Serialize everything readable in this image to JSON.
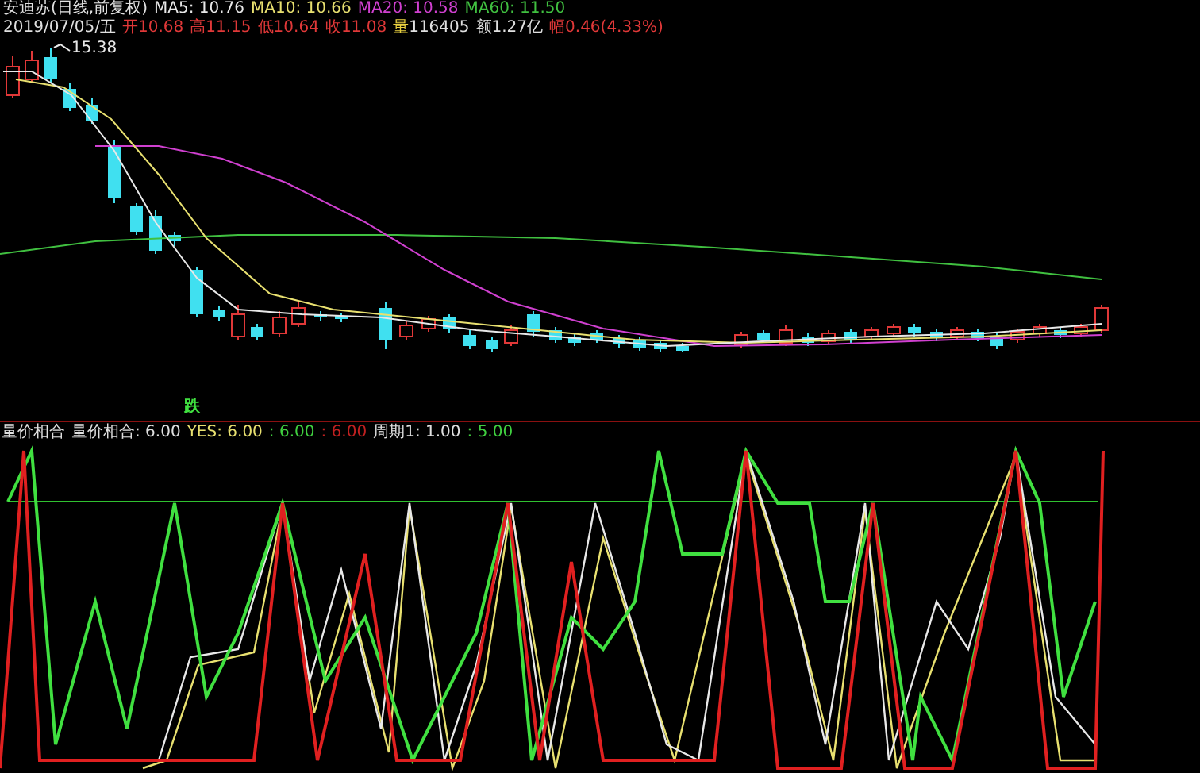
{
  "chart_header": {
    "title": "安迪苏(日线,前复权)",
    "moving_averages": [
      {
        "label": "MA5: 10.76",
        "color": "#e8e8e8"
      },
      {
        "label": "MA10: 10.66",
        "color": "#e8e070"
      },
      {
        "label": "MA20: 10.58",
        "color": "#d040d0"
      },
      {
        "label": "MA60: 11.50",
        "color": "#40c040"
      }
    ]
  },
  "quote_line": [
    {
      "parts": [
        {
          "text": "2019/07/05/五",
          "color": "#e0e0e0"
        }
      ]
    },
    {
      "parts": [
        {
          "text": "开10.68",
          "color": "#e03838"
        }
      ]
    },
    {
      "parts": [
        {
          "text": "高11.15",
          "color": "#e03838"
        }
      ]
    },
    {
      "parts": [
        {
          "text": "低10.64",
          "color": "#e03838"
        }
      ]
    },
    {
      "parts": [
        {
          "text": "收11.08",
          "color": "#e03838"
        }
      ]
    },
    {
      "parts": [
        {
          "text": "量",
          "color": "#e8d040"
        },
        {
          "text": "116405",
          "color": "#e0e0e0"
        }
      ]
    },
    {
      "parts": [
        {
          "text": "额1.27亿",
          "color": "#e0e0e0"
        }
      ]
    },
    {
      "parts": [
        {
          "text": "幅0.46(4.33%)",
          "color": "#e03838"
        }
      ]
    }
  ],
  "price_chart": {
    "high_label": "15.38",
    "signal_label": "跌"
  },
  "indicator": {
    "legend": [
      {
        "text": "量价相合",
        "color": "#e0e0e0"
      },
      {
        "text": "量价相合: 6.00",
        "color": "#e0e0e0"
      },
      {
        "text": "YES: 6.00",
        "color": "#e8e070"
      },
      {
        "text": ": 6.00",
        "color": "#40d040"
      },
      {
        "text": ": 6.00",
        "color": "#c02020"
      },
      {
        "text": "周期1: 1.00",
        "color": "#e0e0e0"
      },
      {
        "text": ": 5.00",
        "color": "#40d040"
      }
    ]
  }
}
